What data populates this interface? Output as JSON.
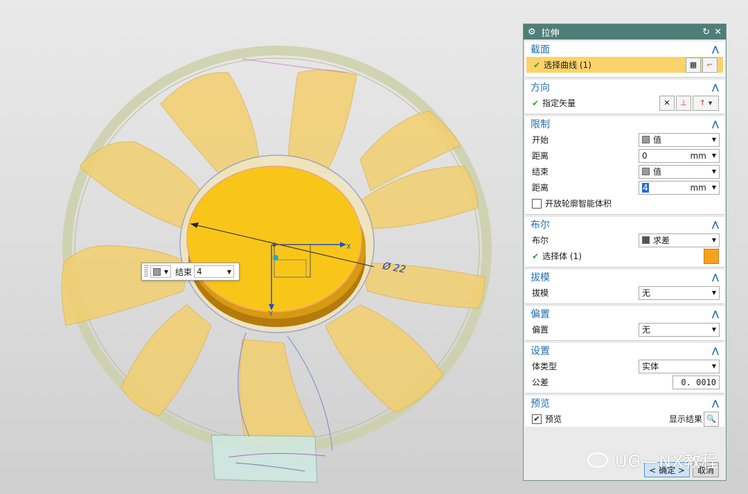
{
  "dialog": {
    "title": "拉伸",
    "sections": {
      "section": {
        "header": "截面",
        "select_curve": "选择曲线 (1)"
      },
      "direction": {
        "header": "方向",
        "specify_vector": "指定矢量"
      },
      "limits": {
        "header": "限制",
        "start_label": "开始",
        "start_value": "值",
        "distance1_label": "距离",
        "distance1_value": "0",
        "distance1_unit": "mm",
        "end_label": "结束",
        "end_value": "值",
        "distance2_label": "距离",
        "distance2_value": "4",
        "distance2_unit": "mm",
        "open_profile": "开放轮廓智能体积"
      },
      "boolean": {
        "header": "布尔",
        "boolean_label": "布尔",
        "boolean_value": "求差",
        "select_body": "选择体 (1)"
      },
      "draft": {
        "header": "拔模",
        "draft_label": "拔模",
        "draft_value": "无"
      },
      "offset": {
        "header": "偏置",
        "offset_label": "偏置",
        "offset_value": "无"
      },
      "settings": {
        "header": "设置",
        "body_type_label": "体类型",
        "body_type_value": "实体",
        "tolerance_label": "公差",
        "tolerance_value": "0. 0010"
      },
      "preview": {
        "header": "预览",
        "preview_label": "预览",
        "show_result": "显示结果"
      }
    },
    "ok_label": "< 确定 >",
    "cancel_label": "取消"
  },
  "viewport": {
    "axis_x": "X",
    "axis_y": "Y",
    "dimension": "Ø 22",
    "float_input": {
      "label": "结束",
      "value": "4"
    }
  },
  "watermark": "UG—NX教程",
  "colors": {
    "titlebar": "#4e7e77",
    "section_header": "#1f6fb2",
    "highlight": "#fbd36b",
    "blade": "#f3cf6a",
    "hub": "#f8c619"
  }
}
